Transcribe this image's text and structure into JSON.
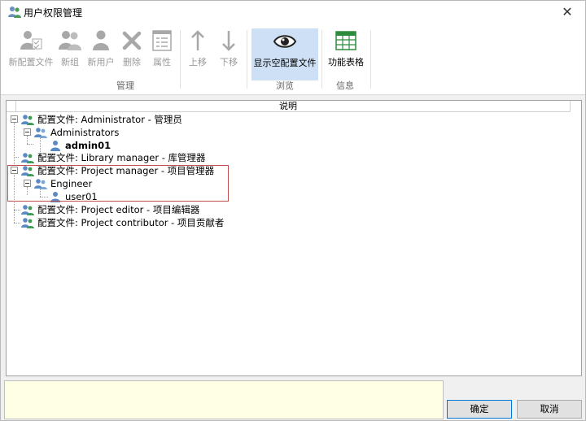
{
  "window": {
    "title": "用户权限管理",
    "close_glyph": "✕"
  },
  "ribbon": {
    "buttons": [
      {
        "label": "新配置文件",
        "icon": "new-profile-icon",
        "enabled": false
      },
      {
        "label": "新组",
        "icon": "new-group-icon",
        "enabled": false
      },
      {
        "label": "新用户",
        "icon": "new-user-icon",
        "enabled": false
      },
      {
        "label": "删除",
        "icon": "delete-icon",
        "enabled": false
      },
      {
        "label": "属性",
        "icon": "properties-icon",
        "enabled": false
      },
      {
        "label": "上移",
        "icon": "arrow-up-icon",
        "enabled": false
      },
      {
        "label": "下移",
        "icon": "arrow-down-icon",
        "enabled": false
      },
      {
        "label": "显示空配置文件",
        "icon": "eye-icon",
        "enabled": true,
        "selected": true
      },
      {
        "label": "功能表格",
        "icon": "table-icon",
        "enabled": true
      }
    ],
    "groups": [
      {
        "label": "管理"
      },
      {
        "label": "浏览"
      },
      {
        "label": "信息"
      }
    ]
  },
  "tree": {
    "header": "说明",
    "nodes": [
      {
        "text": "配置文件: Administrator - 管理员",
        "kind": "profile",
        "level": 0
      },
      {
        "text": "Administrators",
        "kind": "group",
        "level": 1
      },
      {
        "text": "admin01",
        "kind": "user",
        "level": 2,
        "bold": true
      },
      {
        "text": "配置文件: Library manager - 库管理器",
        "kind": "profile",
        "level": 0
      },
      {
        "text": "配置文件: Project manager - 项目管理器",
        "kind": "profile",
        "level": 0
      },
      {
        "text": "Engineer",
        "kind": "group",
        "level": 1
      },
      {
        "text": "user01",
        "kind": "user",
        "level": 2
      },
      {
        "text": "配置文件: Project editor - 项目编辑器",
        "kind": "profile",
        "level": 0
      },
      {
        "text": "配置文件: Project contributor - 项目贡献者",
        "kind": "profile",
        "level": 0
      }
    ]
  },
  "footer": {
    "ok_label": "确定",
    "cancel_label": "取消"
  },
  "colors": {
    "selected_bg": "#cde0f5",
    "highlight_border": "#c0504d",
    "description_bg": "#ffffe6",
    "ok_border": "#0078d7"
  }
}
